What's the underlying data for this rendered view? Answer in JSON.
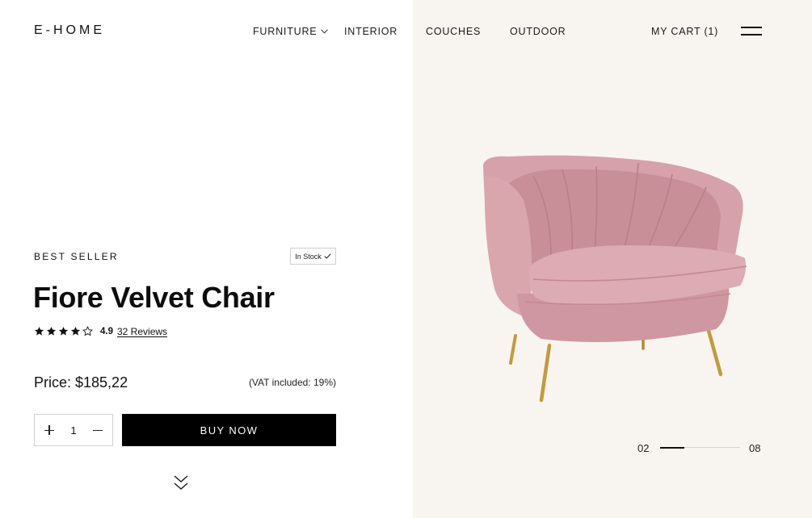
{
  "header": {
    "logo": "E-HOME",
    "nav": [
      {
        "label": "FURNITURE",
        "has_dropdown": true,
        "icon": "chevron-down-icon"
      },
      {
        "label": "INTERIOR"
      },
      {
        "label": "COUCHES"
      },
      {
        "label": "OUTDOOR"
      }
    ],
    "cart_label": "MY CART (1)",
    "menu_icon": "hamburger-menu-icon"
  },
  "product": {
    "eyebrow": "BEST SELLER",
    "stock_label": "In Stock",
    "stock_icon": "check-icon",
    "title": "Fiore Velvet Chair",
    "rating": {
      "stars_filled": 4,
      "stars_total": 5,
      "value": "4.9",
      "reviews_label": "32 Reviews"
    },
    "price": "Price: $185,22",
    "vat": "(VAT included: 19%)",
    "quantity": {
      "value": "1",
      "increment_icon": "plus-icon",
      "decrement_icon": "minus-icon"
    },
    "buy_label": "BUY NOW",
    "scroll_icon": "double-chevron-down-icon",
    "image": {
      "icon": "pink-velvet-chair-image",
      "colors": {
        "velvet": "#d6a1aa",
        "legs": "#c49a3c"
      }
    }
  },
  "gallery": {
    "current": "02",
    "total": "08",
    "progress": 0.3
  },
  "colors": {
    "accent": "#000000",
    "panel_background": "#f8f5f1",
    "background": "#ffffff"
  }
}
